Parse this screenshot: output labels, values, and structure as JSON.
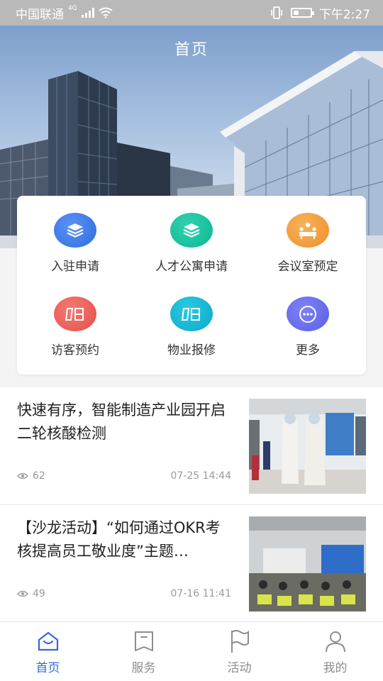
{
  "status_bar": {
    "carrier": "中国联通",
    "network": "4G",
    "time": "下午2:27"
  },
  "header": {
    "title": "首页"
  },
  "quick_menu": {
    "items": [
      {
        "label": "入驻申请",
        "icon": "layers-icon",
        "color": "#3a78ea"
      },
      {
        "label": "人才公寓申请",
        "icon": "layers-icon",
        "color": "#17c19f"
      },
      {
        "label": "会议室预定",
        "icon": "meeting-room-icon",
        "color": "#f29b3b"
      },
      {
        "label": "访客预约",
        "icon": "book-icon",
        "color": "#ea5b54"
      },
      {
        "label": "物业报修",
        "icon": "book-icon",
        "color": "#15b5d2"
      },
      {
        "label": "更多",
        "icon": "more-icon",
        "color": "#6468ec"
      }
    ]
  },
  "news": [
    {
      "title": "快速有序，智能制造产业园开启二轮核酸检测",
      "views": "62",
      "date": "07-25 14:44"
    },
    {
      "title": "【沙龙活动】“如何通过OKR考核提高员工敬业度”主题…",
      "views": "49",
      "date": "07-16 11:41"
    }
  ],
  "tab_bar": {
    "tabs": [
      {
        "label": "首页",
        "icon": "home-icon",
        "active": true
      },
      {
        "label": "服务",
        "icon": "bookmark-icon",
        "active": false
      },
      {
        "label": "活动",
        "icon": "flag-icon",
        "active": false
      },
      {
        "label": "我的",
        "icon": "user-icon",
        "active": false
      }
    ],
    "active_color": "#2d6bd6",
    "inactive_color": "#8d8d8d"
  }
}
